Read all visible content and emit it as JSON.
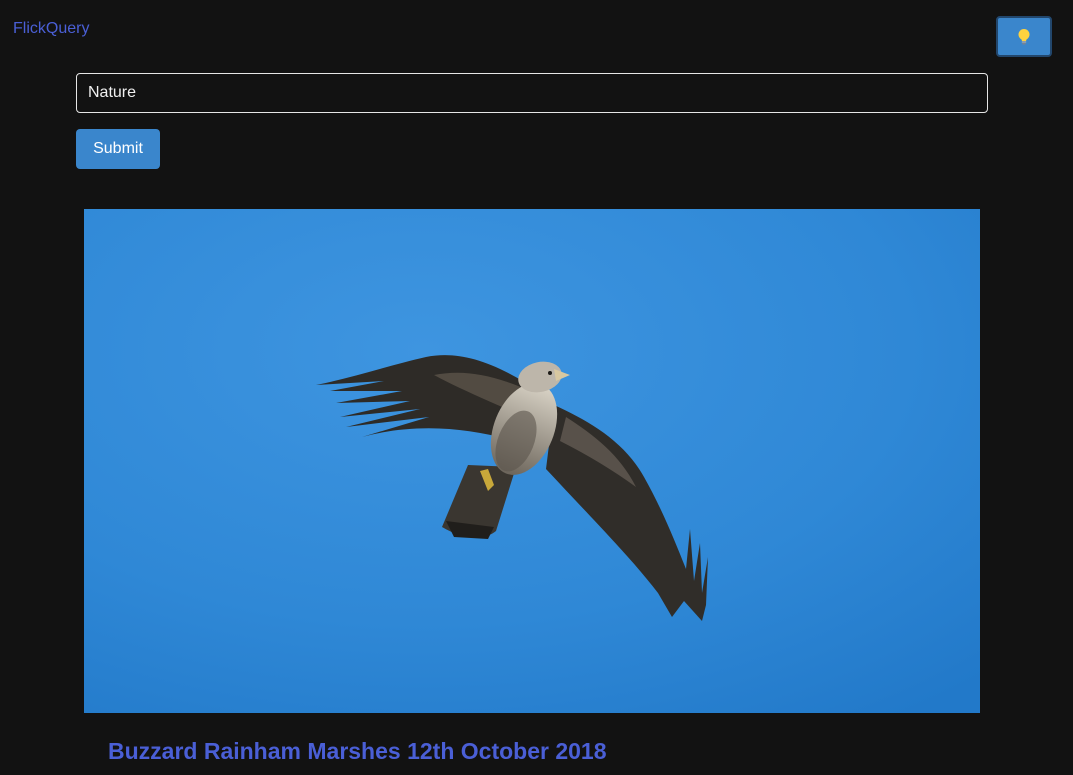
{
  "header": {
    "brand": "FlickQuery",
    "theme_toggle_icon": "lightbulb-icon",
    "theme_toggle_color": "#3a86cc"
  },
  "search": {
    "value": "Nature",
    "submit_label": "Submit"
  },
  "results": [
    {
      "title": "Buzzard Rainham Marshes 12th October 2018",
      "image_subject": "buzzard-in-flight"
    }
  ],
  "colors": {
    "background": "#121212",
    "accent": "#3a86cc",
    "link": "#4a5fd6",
    "sky": "#2f8ad8"
  }
}
